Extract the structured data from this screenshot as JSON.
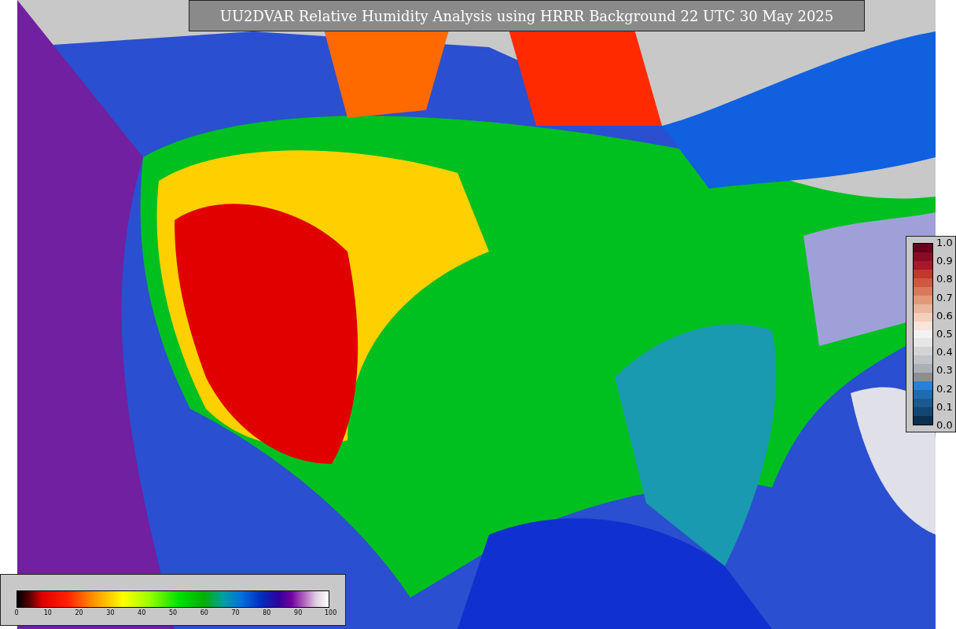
{
  "title": "UU2DVAR Relative Humidity Analysis using HRRR Background 22 UTC 30 May 2025",
  "right_legend": {
    "labels": [
      "1.0",
      "0.9",
      "0.8",
      "0.7",
      "0.6",
      "0.5",
      "0.4",
      "0.3",
      "0.2",
      "0.1",
      "0.0"
    ]
  },
  "bottom_legend": {
    "labels": [
      "0",
      "10",
      "20",
      "30",
      "40",
      "50",
      "60",
      "70",
      "80",
      "90",
      "100"
    ]
  }
}
